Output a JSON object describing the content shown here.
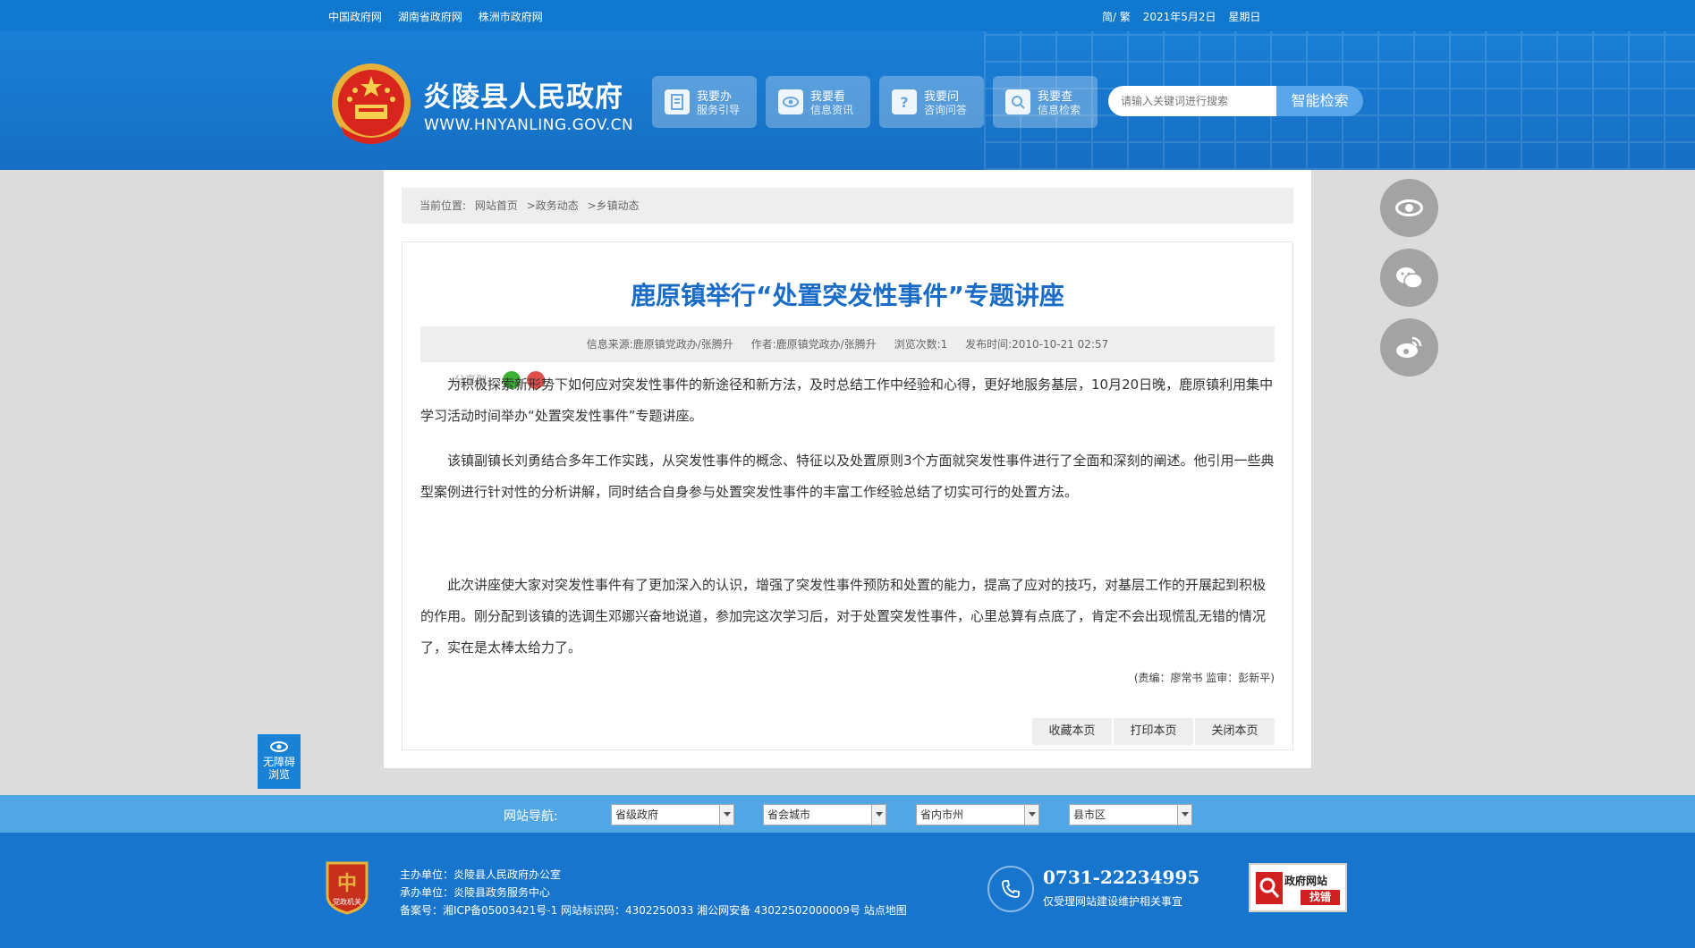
{
  "topbar": {
    "links": [
      "中国政府网",
      "湖南省政府网",
      "株洲市政府网"
    ],
    "lang": "简/ 繁",
    "date": "2021年5月2日",
    "weekday": "星期日"
  },
  "header": {
    "site_title": "炎陵县人民政府",
    "site_domain": "WWW.HNYANLING.GOV.CN",
    "quick": [
      {
        "t1": "我要办",
        "t2": "服务引导"
      },
      {
        "t1": "我要看",
        "t2": "信息资讯"
      },
      {
        "t1": "我要问",
        "t2": "咨询问答"
      },
      {
        "t1": "我要查",
        "t2": "信息检索"
      }
    ],
    "search_placeholder": "请输入关键词进行搜索",
    "search_button": "智能检索"
  },
  "breadcrumb": {
    "label": "当前位置:",
    "items": [
      "网站首页",
      ">政务动态",
      ">乡镇动态"
    ]
  },
  "article": {
    "title": "鹿原镇举行“处置突发性事件”专题讲座",
    "meta": {
      "source": "信息来源:鹿原镇党政办/张腾升",
      "author": "作者:鹿原镇党政办/张腾升",
      "views": "浏览次数:1",
      "published": "发布时间:2010-10-21 02:57"
    },
    "share_label": "分享到:",
    "paragraphs": [
      "为积极探索新形势下如何应对突发性事件的新途径和新方法，及时总结工作中经验和心得，更好地服务基层，10月20日晚，鹿原镇利用集中学习活动时间举办“处置突发性事件”专题讲座。",
      "该镇副镇长刘勇结合多年工作实践，从突发性事件的概念、特征以及处置原则3个方面就突发性事件进行了全面和深刻的阐述。他引用一些典型案例进行针对性的分析讲解，同时结合自身参与处置突发性事件的丰富工作经验总结了切实可行的处置方法。",
      "此次讲座使大家对突发性事件有了更加深入的认识，增强了突发性事件预防和处置的能力，提高了应对的技巧，对基层工作的开展起到积极的作用。刚分配到该镇的选调生邓娜兴奋地说道，参加完这次学习后，对于处置突发性事件，心里总算有点底了，肯定不会出现慌乱无错的情况了，实在是太棒太给力了。"
    ],
    "editor": "(责编：廖常书   监审：彭新平)",
    "buttons": [
      "收藏本页",
      "打印本页",
      "关闭本页"
    ]
  },
  "accessibility": {
    "line1": "无障碍",
    "line2": "浏览"
  },
  "navbar": {
    "label": "网站导航:",
    "selects": [
      "省级政府",
      "省会城市",
      "省内市州",
      "县市区"
    ]
  },
  "footer": {
    "host": "主办单位：炎陵县人民政府办公室",
    "organizer": "承办单位：炎陵县政务服务中心",
    "record": "备案号：湘ICP备05003421号-1 网站标识码：4302250033 湘公网安备 43022502000009号 站点地图",
    "badge_text": "党政机关",
    "phone": "0731-22234995",
    "phone_note": "仅受理网站建设维护相关事宜",
    "jiucuo_line1": "政府网站",
    "jiucuo_line2": "找错"
  },
  "colors": {
    "primary": "#1178cf",
    "title": "#1a6cc7",
    "nav": "#51a7e6",
    "footer": "#1775cd"
  }
}
